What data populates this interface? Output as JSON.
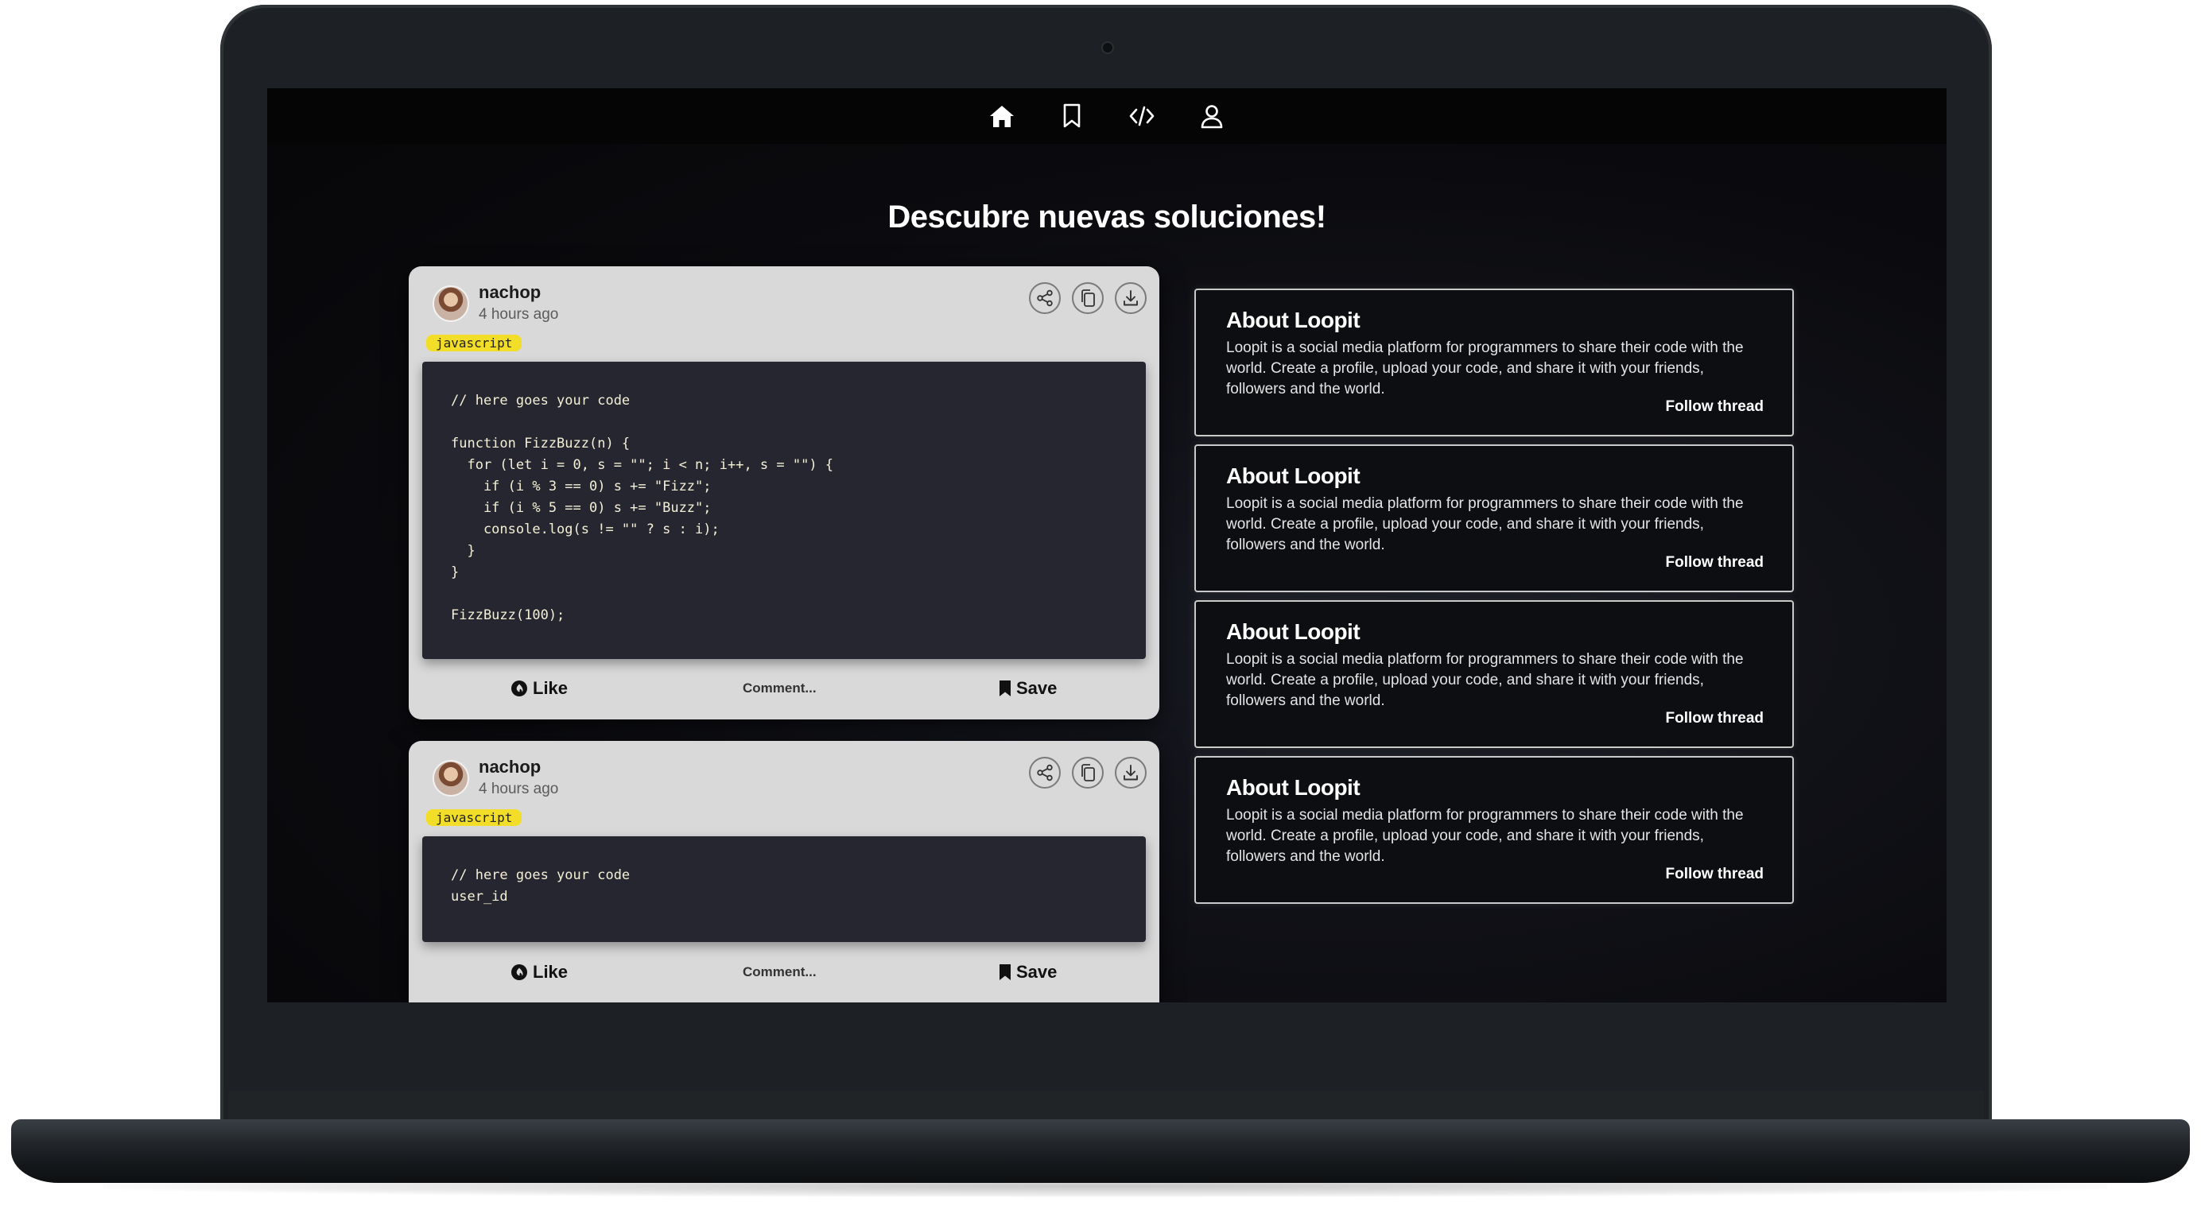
{
  "nav": {
    "icons": [
      "home-icon",
      "bookmark-icon",
      "code-icon",
      "user-icon"
    ]
  },
  "page": {
    "title": "Descubre nuevas soluciones!"
  },
  "posts": [
    {
      "username": "nachop",
      "time": "4 hours ago",
      "tag": "javascript",
      "code": "// here goes your code\n\nfunction FizzBuzz(n) {\n  for (let i = 0, s = \"\"; i < n; i++, s = \"\") {\n    if (i % 3 == 0) s += \"Fizz\";\n    if (i % 5 == 0) s += \"Buzz\";\n    console.log(s != \"\" ? s : i);\n  }\n}\n\nFizzBuzz(100);",
      "like_label": "Like",
      "comment_label": "Comment...",
      "save_label": "Save"
    },
    {
      "username": "nachop",
      "time": "4 hours ago",
      "tag": "javascript",
      "code": "// here goes your code\nuser_id",
      "like_label": "Like",
      "comment_label": "Comment...",
      "save_label": "Save"
    }
  ],
  "about_cards": [
    {
      "title": "About Loopit",
      "text": "Loopit is a social media platform for programmers to share their code with the world. Create a profile, upload your code, and share it with your friends, followers and the world.",
      "follow_label": "Follow thread"
    },
    {
      "title": "About Loopit",
      "text": "Loopit is a social media platform for programmers to share their code with the world. Create a profile, upload your code, and share it with your friends, followers and the world.",
      "follow_label": "Follow thread"
    },
    {
      "title": "About Loopit",
      "text": "Loopit is a social media platform for programmers to share their code with the world. Create a profile, upload your code, and share it with your friends, followers and the world.",
      "follow_label": "Follow thread"
    },
    {
      "title": "About Loopit",
      "text": "Loopit is a social media platform for programmers to share their code with the world. Create a profile, upload your code, and share it with your friends, followers and the world.",
      "follow_label": "Follow thread"
    }
  ],
  "colors": {
    "tag_bg": "#f2de28",
    "card_bg": "#d9d9da",
    "code_bg": "#262630",
    "screen_bg": "#0b0b0f"
  }
}
